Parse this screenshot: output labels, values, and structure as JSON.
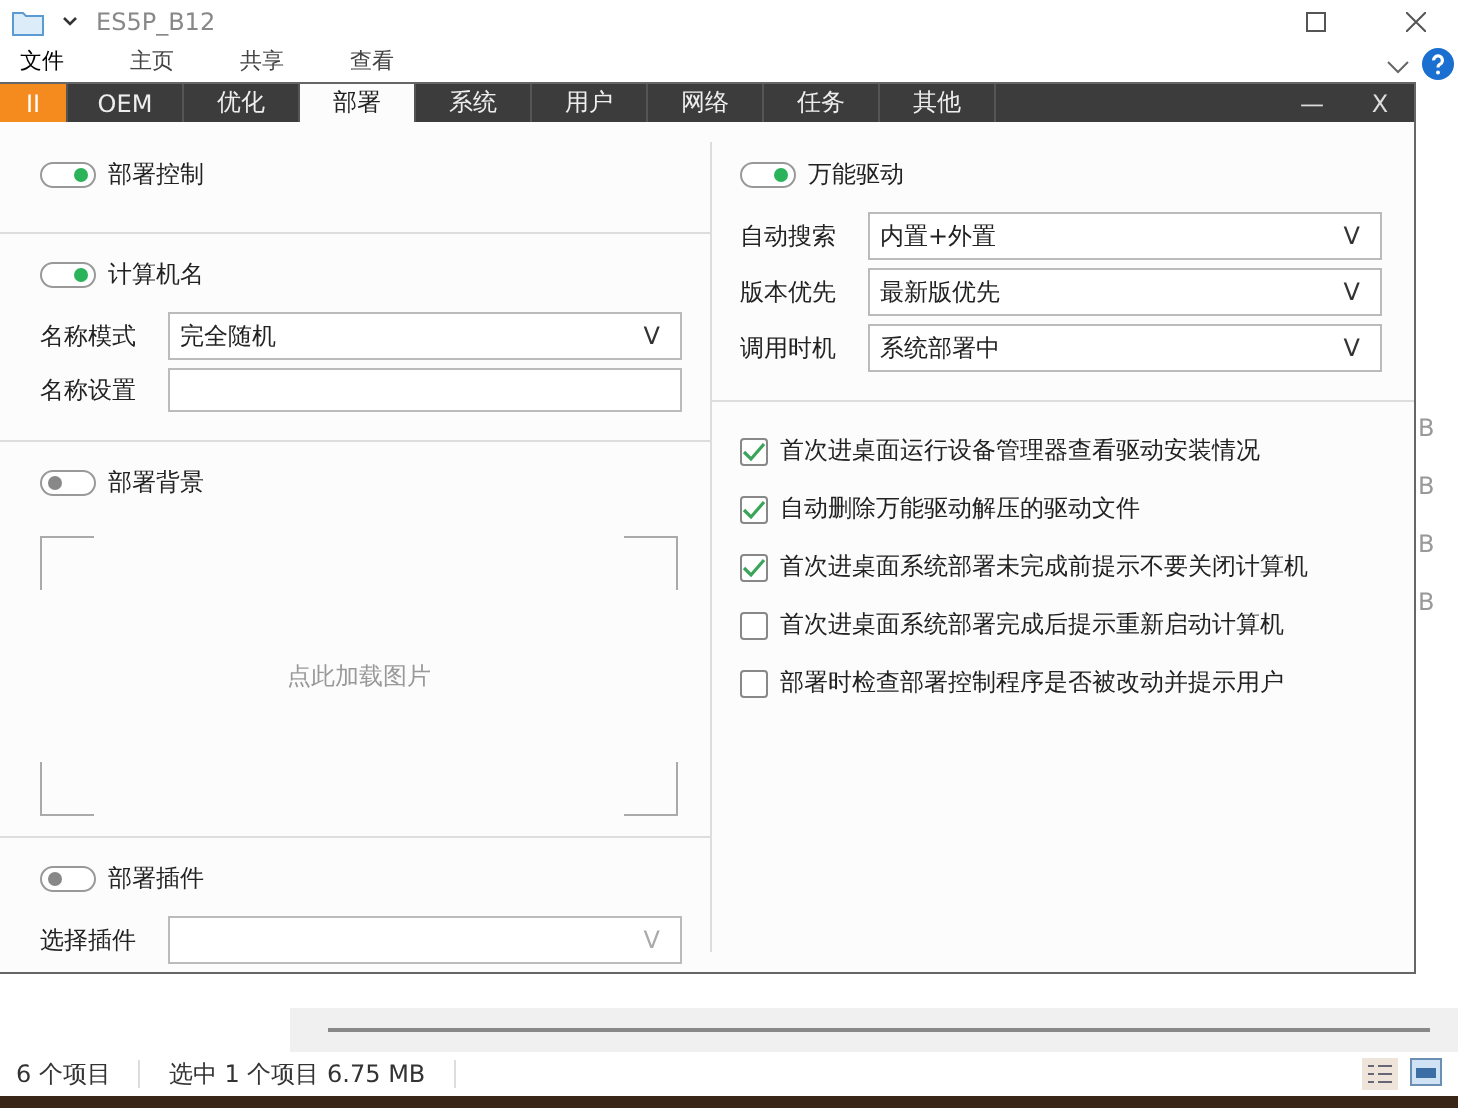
{
  "explorer": {
    "title": "ES5P_B12",
    "menu": [
      {
        "label": "文件",
        "selected": true
      },
      {
        "label": "主页",
        "selected": false
      },
      {
        "label": "共享",
        "selected": false
      },
      {
        "label": "查看",
        "selected": false
      }
    ],
    "partial_sizes": [
      "B",
      "B",
      "B",
      "B"
    ],
    "status_bar": {
      "count": "6 个项目",
      "selection": "选中 1 个项目  6.75 MB"
    }
  },
  "dialog": {
    "tabs": [
      {
        "label": "II",
        "kind": "accent",
        "selected": false
      },
      {
        "label": "OEM",
        "kind": "normal",
        "selected": false
      },
      {
        "label": "优化",
        "kind": "normal",
        "selected": false
      },
      {
        "label": "部署",
        "kind": "normal",
        "selected": true
      },
      {
        "label": "系统",
        "kind": "normal",
        "selected": false
      },
      {
        "label": "用户",
        "kind": "normal",
        "selected": false
      },
      {
        "label": "网络",
        "kind": "normal",
        "selected": false
      },
      {
        "label": "任务",
        "kind": "normal",
        "selected": false
      },
      {
        "label": "其他",
        "kind": "normal",
        "selected": false
      }
    ],
    "minimize": "—",
    "close": "X",
    "left": [
      {
        "kind": "toggle",
        "label": "部署控制",
        "on": true
      },
      {
        "kind": "divider"
      },
      {
        "kind": "toggle",
        "label": "计算机名",
        "on": true
      },
      {
        "kind": "select",
        "label": "名称模式",
        "value": "完全随机",
        "arrow": "V",
        "disabled": false
      },
      {
        "kind": "input",
        "label": "名称设置"
      },
      {
        "kind": "divider"
      },
      {
        "kind": "toggle",
        "label": "部署背景",
        "on": false
      },
      {
        "kind": "image",
        "hint": "点此加载图片"
      },
      {
        "kind": "divider"
      },
      {
        "kind": "toggle",
        "label": "部署插件",
        "on": false
      },
      {
        "kind": "select",
        "label": "选择插件",
        "arrow": "V",
        "disabled": true
      }
    ],
    "right": [
      {
        "kind": "toggle",
        "label": "万能驱动",
        "on": true
      },
      {
        "kind": "select",
        "label": "自动搜索",
        "value": "内置+外置",
        "arrow": "V",
        "disabled": false
      },
      {
        "kind": "select",
        "label": "版本优先",
        "value": "最新版优先",
        "arrow": "V",
        "disabled": false
      },
      {
        "kind": "select",
        "label": "调用时机",
        "value": "系统部署中",
        "arrow": "V",
        "disabled": false
      },
      {
        "kind": "divider"
      },
      {
        "kind": "check",
        "label": "首次进桌面运行设备管理器查看驱动安装情况",
        "checked": true
      },
      {
        "kind": "check",
        "label": "自动删除万能驱动解压的驱动文件",
        "checked": true
      },
      {
        "kind": "check",
        "label": "首次进桌面系统部署未完成前提示不要关闭计算机",
        "checked": true
      },
      {
        "kind": "check",
        "label": "首次进桌面系统部署完成后提示重新启动计算机",
        "checked": false
      },
      {
        "kind": "check",
        "label": "部署时检查部署控制程序是否被改动并提示用户",
        "checked": false
      }
    ]
  }
}
